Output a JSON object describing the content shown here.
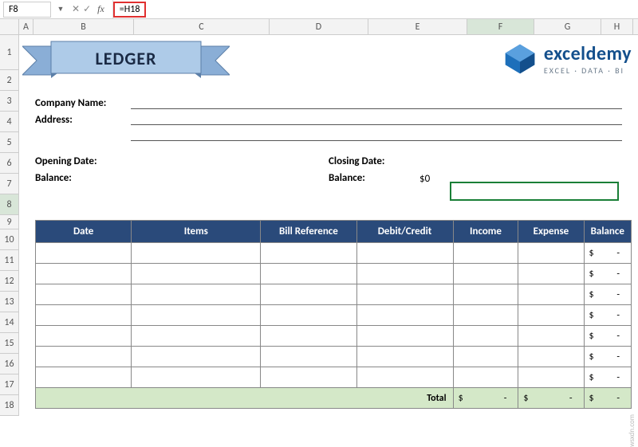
{
  "formula_bar": {
    "cell_ref": "F8",
    "formula": "=H18"
  },
  "columns": [
    "A",
    "B",
    "C",
    "D",
    "E",
    "F",
    "G",
    "H"
  ],
  "rows": [
    "1",
    "2",
    "3",
    "4",
    "5",
    "6",
    "7",
    "8",
    "9",
    "10",
    "11",
    "12",
    "13",
    "14",
    "15",
    "16",
    "17",
    "18"
  ],
  "banner": {
    "title": "LEDGER"
  },
  "logo": {
    "brand": "exceldemy",
    "tagline": "EXCEL · DATA · BI"
  },
  "info": {
    "company_label": "Company Name:",
    "address_label": "Address:",
    "opening_date_label": "Opening Date:",
    "closing_date_label": "Closing Date:",
    "opening_bal_label": "Balance:",
    "closing_bal_label": "Balance:",
    "closing_bal_value": "$0"
  },
  "table": {
    "headers": [
      "Date",
      "Items",
      "Bill Reference",
      "Debit/Credit",
      "Income",
      "Expense",
      "Balance"
    ],
    "balance_currency": "$",
    "balance_dash": "-",
    "total_label": "Total"
  },
  "watermark": "wsxdn.com",
  "chart_data": {
    "type": "table",
    "title": "LEDGER",
    "columns": [
      "Date",
      "Items",
      "Bill Reference",
      "Debit/Credit",
      "Income",
      "Expense",
      "Balance"
    ],
    "rows": [
      {
        "Date": "",
        "Items": "",
        "Bill Reference": "",
        "Debit/Credit": "",
        "Income": "",
        "Expense": "",
        "Balance": "$ -"
      },
      {
        "Date": "",
        "Items": "",
        "Bill Reference": "",
        "Debit/Credit": "",
        "Income": "",
        "Expense": "",
        "Balance": "$ -"
      },
      {
        "Date": "",
        "Items": "",
        "Bill Reference": "",
        "Debit/Credit": "",
        "Income": "",
        "Expense": "",
        "Balance": "$ -"
      },
      {
        "Date": "",
        "Items": "",
        "Bill Reference": "",
        "Debit/Credit": "",
        "Income": "",
        "Expense": "",
        "Balance": "$ -"
      },
      {
        "Date": "",
        "Items": "",
        "Bill Reference": "",
        "Debit/Credit": "",
        "Income": "",
        "Expense": "",
        "Balance": "$ -"
      },
      {
        "Date": "",
        "Items": "",
        "Bill Reference": "",
        "Debit/Credit": "",
        "Income": "",
        "Expense": "",
        "Balance": "$ -"
      },
      {
        "Date": "",
        "Items": "",
        "Bill Reference": "",
        "Debit/Credit": "",
        "Income": "",
        "Expense": "",
        "Balance": "$ -"
      }
    ],
    "totals": {
      "Income": "$ -",
      "Expense": "$ -",
      "Balance": "$ -"
    }
  }
}
